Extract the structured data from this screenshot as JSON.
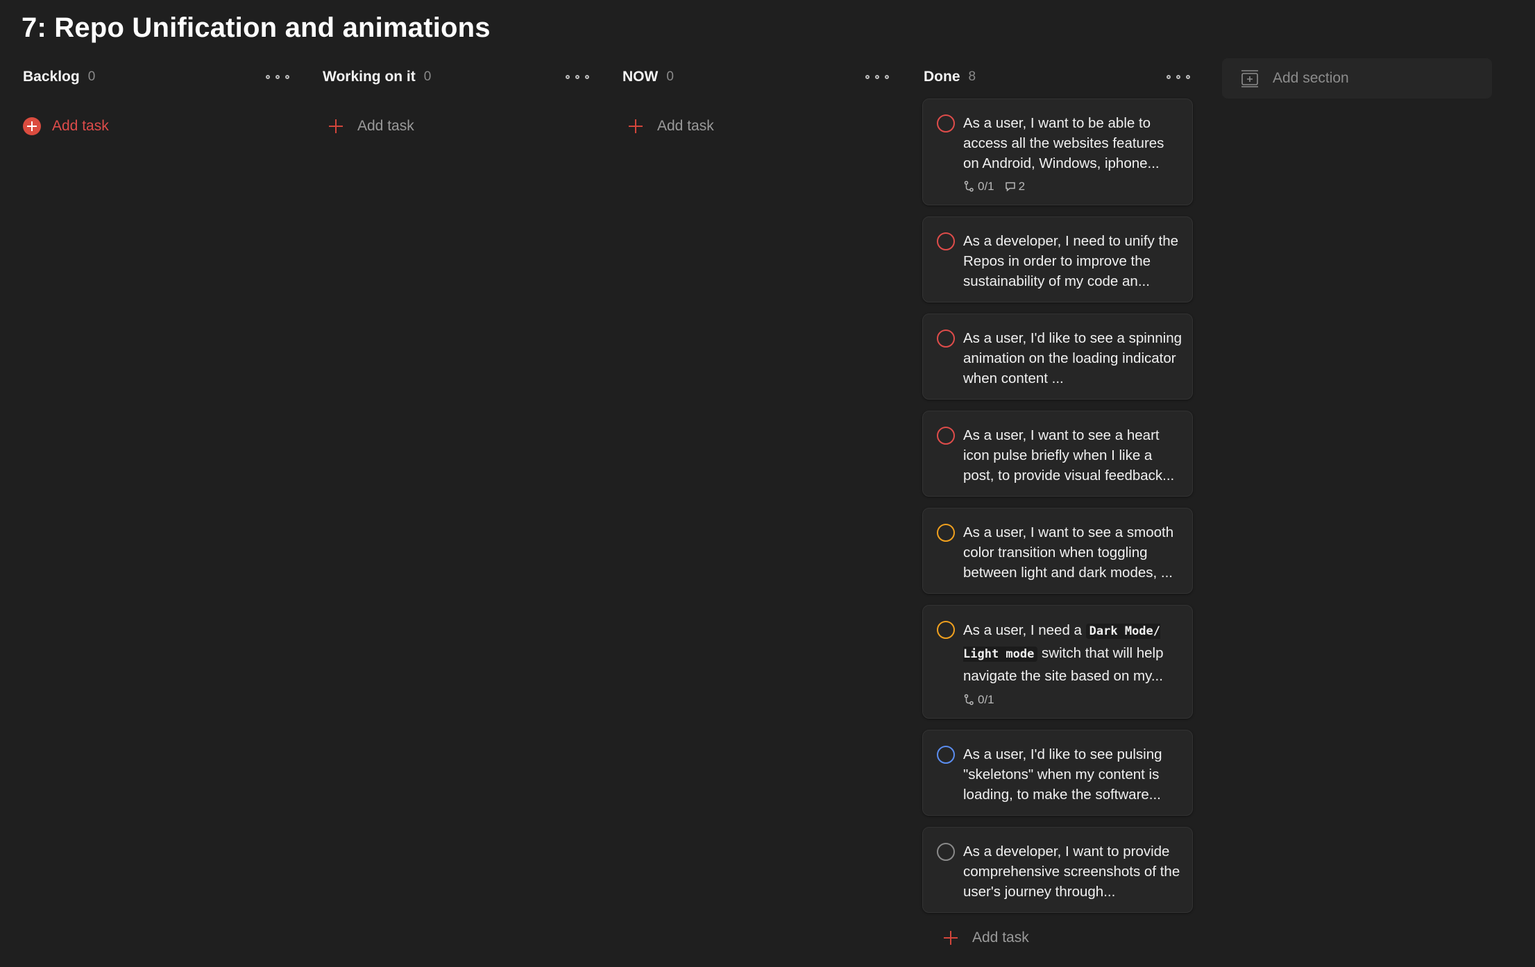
{
  "project": {
    "title": "7: Repo Unification and animations"
  },
  "colors": {
    "background": "#1f1f1f",
    "card": "#262626",
    "accent": "#de4c4a",
    "priority_1": "#de4c4a",
    "priority_2": "#f0a01e",
    "priority_3": "#5b8def",
    "priority_4": "#8a8a8a"
  },
  "icons": {
    "section_menu": "more-horizontal-icon",
    "add_task": "plus-icon",
    "add_task_hover": "plus-circle-icon",
    "subtasks": "subtask-icon",
    "comments": "comment-icon",
    "add_section": "add-section-icon"
  },
  "sections": [
    {
      "name": "Backlog",
      "count": "0",
      "add_task_label": "Add task"
    },
    {
      "name": "Working on it",
      "count": "0",
      "add_task_label": "Add task"
    },
    {
      "name": "NOW",
      "count": "0",
      "add_task_label": "Add task"
    },
    {
      "name": "Done",
      "count": "8",
      "add_task_label": "Add task",
      "tasks": [
        {
          "text": "As a user, I want to be able to access all the websites features on Android, Windows, iphone...",
          "priority_color": "#de4c4a",
          "subtasks": "0/1",
          "comments": "2"
        },
        {
          "text": "As a developer, I need to unify the Repos in order to improve the sustainability of my code an...",
          "priority_color": "#de4c4a"
        },
        {
          "text": "As a user, I'd like to see a spinning animation on the loading indicator when content ...",
          "priority_color": "#de4c4a"
        },
        {
          "text": "As a user, I want to see a heart icon pulse briefly when I like a post, to provide visual feedback...",
          "priority_color": "#de4c4a"
        },
        {
          "text": "As a user, I want to see a smooth color transition when toggling between light and dark modes, ...",
          "priority_color": "#f0a01e"
        },
        {
          "text_before": "As a user, I need a ",
          "code": "Dark Mode/ Light mode",
          "text_after": " switch that will help navigate the site based on my...",
          "priority_color": "#f0a01e",
          "subtasks": "0/1"
        },
        {
          "text": "As a user, I'd like to see pulsing \"skeletons\" when my content is loading, to make the software...",
          "priority_color": "#5b8def"
        },
        {
          "text": "As a developer, I want to provide comprehensive screenshots of the user's journey through...",
          "priority_color": "#8a8a8a"
        }
      ]
    }
  ],
  "add_section": {
    "label": "Add section"
  }
}
